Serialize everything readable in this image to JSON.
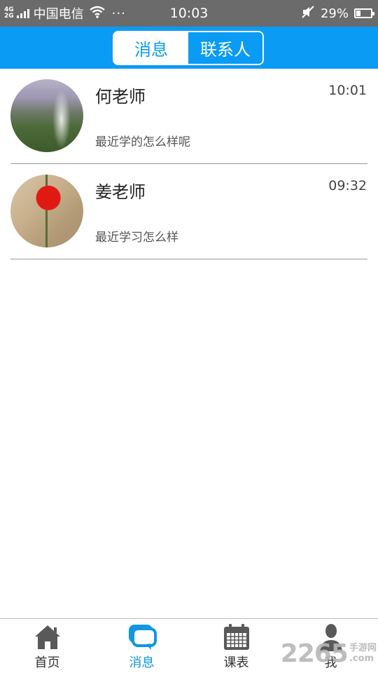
{
  "status_bar": {
    "network_top": "4G",
    "network_bottom": "2G",
    "carrier": "中国电信",
    "more": "···",
    "time": "10:03",
    "battery_percent": "29%",
    "battery_level": 0.29
  },
  "header": {
    "tabs": [
      {
        "label": "消息",
        "active": true
      },
      {
        "label": "联系人",
        "active": false
      }
    ]
  },
  "conversations": [
    {
      "name": "何老师",
      "time": "10:01",
      "last_message": "最近学的怎么样呢",
      "avatar": "waterfall-photo"
    },
    {
      "name": "姜老师",
      "time": "09:32",
      "last_message": "最近学习怎么样",
      "avatar": "poppy-photo"
    }
  ],
  "bottom_nav": [
    {
      "label": "首页",
      "icon": "home-icon",
      "active": false
    },
    {
      "label": "消息",
      "icon": "message-icon",
      "active": true
    },
    {
      "label": "课表",
      "icon": "calendar-icon",
      "active": false
    },
    {
      "label": "我",
      "icon": "person-icon",
      "active": false
    }
  ],
  "watermark": {
    "main": "2265",
    "sub_top": "手游网",
    "sub_bottom": ".com"
  },
  "colors": {
    "accent": "#0a9bf5",
    "active_tab_text": "#1296e6",
    "status_bar": "#6b6b6b"
  }
}
